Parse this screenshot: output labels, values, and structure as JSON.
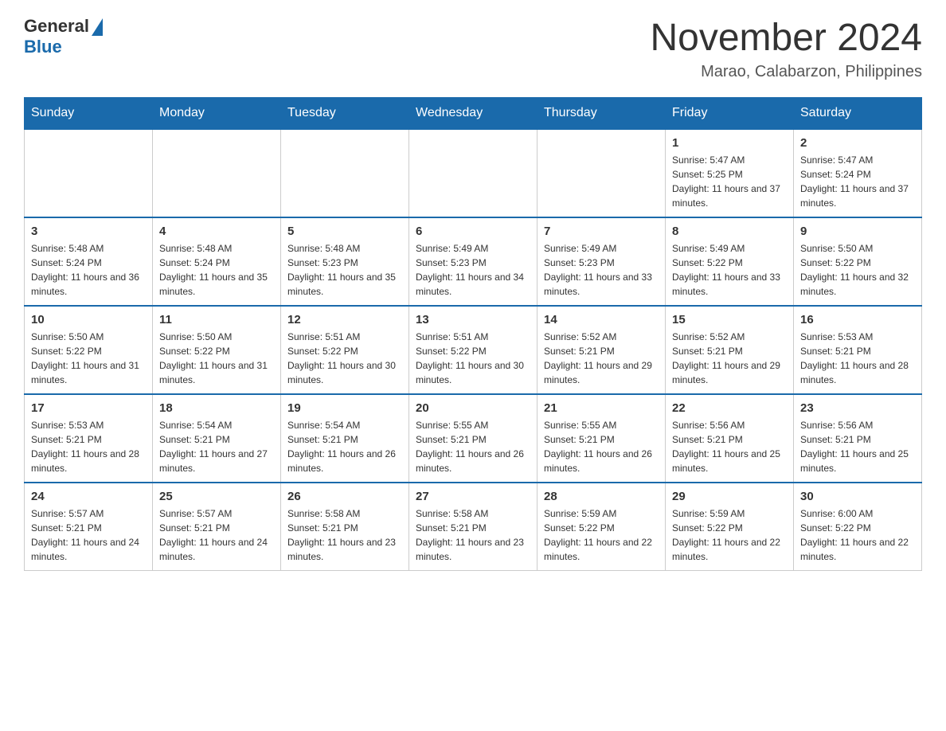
{
  "header": {
    "logo_general": "General",
    "logo_blue": "Blue",
    "title": "November 2024",
    "subtitle": "Marao, Calabarzon, Philippines"
  },
  "days_of_week": [
    "Sunday",
    "Monday",
    "Tuesday",
    "Wednesday",
    "Thursday",
    "Friday",
    "Saturday"
  ],
  "weeks": [
    {
      "days": [
        {
          "number": "",
          "info": ""
        },
        {
          "number": "",
          "info": ""
        },
        {
          "number": "",
          "info": ""
        },
        {
          "number": "",
          "info": ""
        },
        {
          "number": "",
          "info": ""
        },
        {
          "number": "1",
          "info": "Sunrise: 5:47 AM\nSunset: 5:25 PM\nDaylight: 11 hours and 37 minutes."
        },
        {
          "number": "2",
          "info": "Sunrise: 5:47 AM\nSunset: 5:24 PM\nDaylight: 11 hours and 37 minutes."
        }
      ]
    },
    {
      "days": [
        {
          "number": "3",
          "info": "Sunrise: 5:48 AM\nSunset: 5:24 PM\nDaylight: 11 hours and 36 minutes."
        },
        {
          "number": "4",
          "info": "Sunrise: 5:48 AM\nSunset: 5:24 PM\nDaylight: 11 hours and 35 minutes."
        },
        {
          "number": "5",
          "info": "Sunrise: 5:48 AM\nSunset: 5:23 PM\nDaylight: 11 hours and 35 minutes."
        },
        {
          "number": "6",
          "info": "Sunrise: 5:49 AM\nSunset: 5:23 PM\nDaylight: 11 hours and 34 minutes."
        },
        {
          "number": "7",
          "info": "Sunrise: 5:49 AM\nSunset: 5:23 PM\nDaylight: 11 hours and 33 minutes."
        },
        {
          "number": "8",
          "info": "Sunrise: 5:49 AM\nSunset: 5:22 PM\nDaylight: 11 hours and 33 minutes."
        },
        {
          "number": "9",
          "info": "Sunrise: 5:50 AM\nSunset: 5:22 PM\nDaylight: 11 hours and 32 minutes."
        }
      ]
    },
    {
      "days": [
        {
          "number": "10",
          "info": "Sunrise: 5:50 AM\nSunset: 5:22 PM\nDaylight: 11 hours and 31 minutes."
        },
        {
          "number": "11",
          "info": "Sunrise: 5:50 AM\nSunset: 5:22 PM\nDaylight: 11 hours and 31 minutes."
        },
        {
          "number": "12",
          "info": "Sunrise: 5:51 AM\nSunset: 5:22 PM\nDaylight: 11 hours and 30 minutes."
        },
        {
          "number": "13",
          "info": "Sunrise: 5:51 AM\nSunset: 5:22 PM\nDaylight: 11 hours and 30 minutes."
        },
        {
          "number": "14",
          "info": "Sunrise: 5:52 AM\nSunset: 5:21 PM\nDaylight: 11 hours and 29 minutes."
        },
        {
          "number": "15",
          "info": "Sunrise: 5:52 AM\nSunset: 5:21 PM\nDaylight: 11 hours and 29 minutes."
        },
        {
          "number": "16",
          "info": "Sunrise: 5:53 AM\nSunset: 5:21 PM\nDaylight: 11 hours and 28 minutes."
        }
      ]
    },
    {
      "days": [
        {
          "number": "17",
          "info": "Sunrise: 5:53 AM\nSunset: 5:21 PM\nDaylight: 11 hours and 28 minutes."
        },
        {
          "number": "18",
          "info": "Sunrise: 5:54 AM\nSunset: 5:21 PM\nDaylight: 11 hours and 27 minutes."
        },
        {
          "number": "19",
          "info": "Sunrise: 5:54 AM\nSunset: 5:21 PM\nDaylight: 11 hours and 26 minutes."
        },
        {
          "number": "20",
          "info": "Sunrise: 5:55 AM\nSunset: 5:21 PM\nDaylight: 11 hours and 26 minutes."
        },
        {
          "number": "21",
          "info": "Sunrise: 5:55 AM\nSunset: 5:21 PM\nDaylight: 11 hours and 26 minutes."
        },
        {
          "number": "22",
          "info": "Sunrise: 5:56 AM\nSunset: 5:21 PM\nDaylight: 11 hours and 25 minutes."
        },
        {
          "number": "23",
          "info": "Sunrise: 5:56 AM\nSunset: 5:21 PM\nDaylight: 11 hours and 25 minutes."
        }
      ]
    },
    {
      "days": [
        {
          "number": "24",
          "info": "Sunrise: 5:57 AM\nSunset: 5:21 PM\nDaylight: 11 hours and 24 minutes."
        },
        {
          "number": "25",
          "info": "Sunrise: 5:57 AM\nSunset: 5:21 PM\nDaylight: 11 hours and 24 minutes."
        },
        {
          "number": "26",
          "info": "Sunrise: 5:58 AM\nSunset: 5:21 PM\nDaylight: 11 hours and 23 minutes."
        },
        {
          "number": "27",
          "info": "Sunrise: 5:58 AM\nSunset: 5:21 PM\nDaylight: 11 hours and 23 minutes."
        },
        {
          "number": "28",
          "info": "Sunrise: 5:59 AM\nSunset: 5:22 PM\nDaylight: 11 hours and 22 minutes."
        },
        {
          "number": "29",
          "info": "Sunrise: 5:59 AM\nSunset: 5:22 PM\nDaylight: 11 hours and 22 minutes."
        },
        {
          "number": "30",
          "info": "Sunrise: 6:00 AM\nSunset: 5:22 PM\nDaylight: 11 hours and 22 minutes."
        }
      ]
    }
  ]
}
